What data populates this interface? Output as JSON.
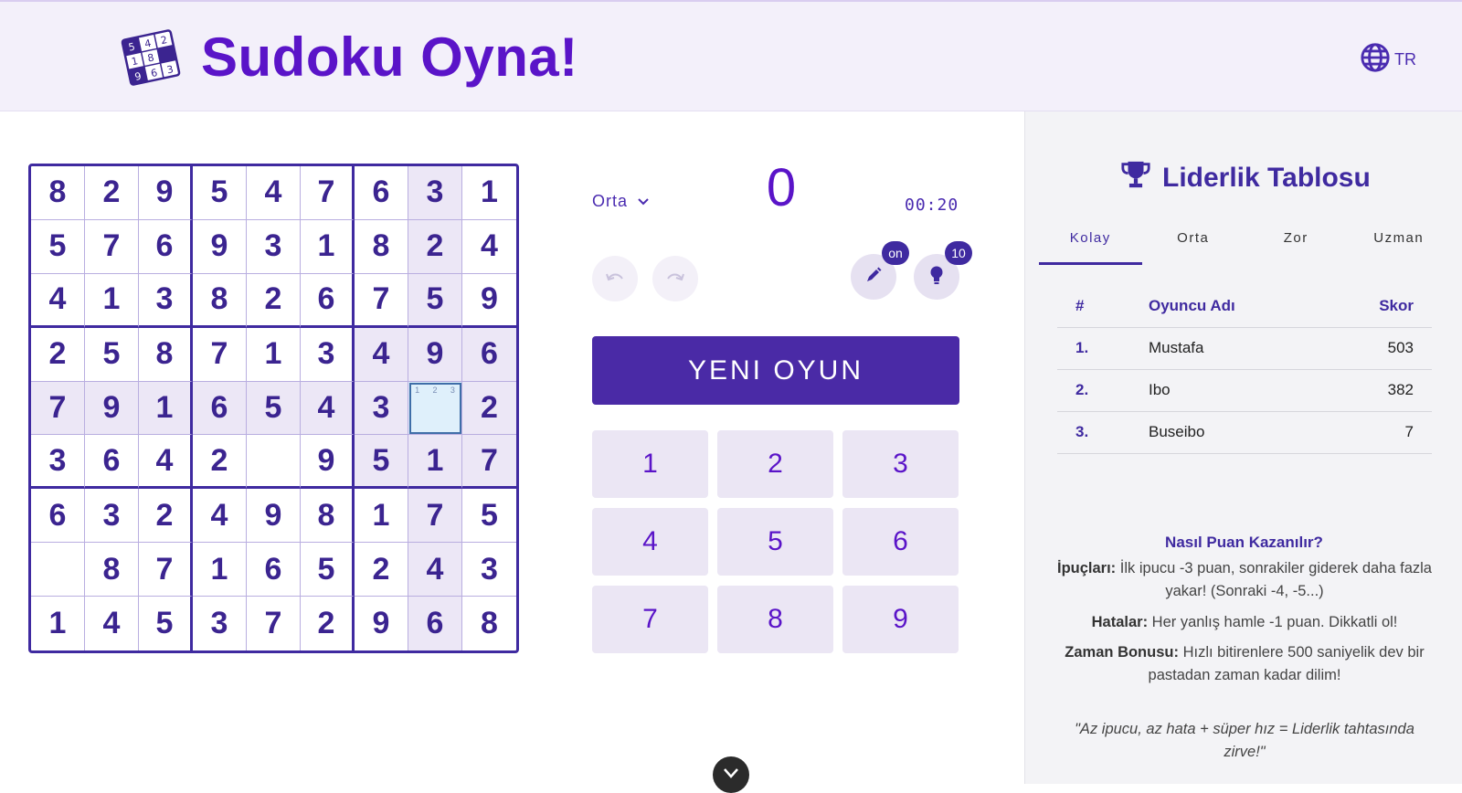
{
  "header": {
    "title": "Sudoku Oyna!",
    "logo_digits": [
      "5",
      "4",
      "2",
      "1",
      "8",
      "9",
      "6",
      "3"
    ],
    "language": "TR"
  },
  "board": {
    "cells": [
      [
        "8",
        "2",
        "9",
        "5",
        "4",
        "7",
        "6",
        "3",
        "1"
      ],
      [
        "5",
        "7",
        "6",
        "9",
        "3",
        "1",
        "8",
        "2",
        "4"
      ],
      [
        "4",
        "1",
        "3",
        "8",
        "2",
        "6",
        "7",
        "5",
        "9"
      ],
      [
        "2",
        "5",
        "8",
        "7",
        "1",
        "3",
        "4",
        "9",
        "6"
      ],
      [
        "7",
        "9",
        "1",
        "6",
        "5",
        "4",
        "3",
        "",
        "2"
      ],
      [
        "3",
        "6",
        "4",
        "2",
        "",
        "9",
        "5",
        "1",
        "7"
      ],
      [
        "6",
        "3",
        "2",
        "4",
        "9",
        "8",
        "1",
        "7",
        "5"
      ],
      [
        "",
        "8",
        "7",
        "1",
        "6",
        "5",
        "2",
        "4",
        "3"
      ],
      [
        "1",
        "4",
        "5",
        "3",
        "7",
        "2",
        "9",
        "6",
        "8"
      ]
    ],
    "selected_cell_notes": [
      "1",
      "2",
      "3"
    ]
  },
  "controls": {
    "difficulty": "Orta",
    "score": "0",
    "timer": "00:20",
    "pencil_badge": "on",
    "hint_badge": "10",
    "new_game_label": "YENI OYUN",
    "numpad": [
      "1",
      "2",
      "3",
      "4",
      "5",
      "6",
      "7",
      "8",
      "9"
    ]
  },
  "leaderboard": {
    "title": "Liderlik Tablosu",
    "tabs": [
      "Kolay",
      "Orta",
      "Zor",
      "Uzman"
    ],
    "active_tab": "Kolay",
    "columns": {
      "rank": "#",
      "name": "Oyuncu Adı",
      "score": "Skor"
    },
    "rows": [
      {
        "rank": "1.",
        "name": "Mustafa",
        "score": "503"
      },
      {
        "rank": "2.",
        "name": "Ibo",
        "score": "382"
      },
      {
        "rank": "3.",
        "name": "Buseibo",
        "score": "7"
      }
    ]
  },
  "rules": {
    "title": "Nasıl Puan Kazanılır?",
    "hints_label": "İpuçları:",
    "hints_text": "İlk ipucu -3 puan, sonrakiler giderek daha fazla yakar! (Sonraki -4, -5...)",
    "errors_label": "Hatalar:",
    "errors_text": "Her yanlış hamle -1 puan. Dikkatli ol!",
    "time_label": "Zaman Bonusu:",
    "time_text": "Hızlı bitirenlere 500 saniyelik dev bir pastadan zaman kadar dilim!",
    "quote": "\"Az ipucu, az hata + süper hız = Liderlik tahtasında zirve!\""
  },
  "colors": {
    "brand": "#5a14c8",
    "primary": "#4a2aa6",
    "highlight": "#ece7f6",
    "selected": "#dff0fb"
  },
  "icons": [
    "sudoku-logo-icon",
    "globe-icon",
    "chevron-down-icon",
    "undo-icon",
    "redo-icon",
    "pencil-icon",
    "lightbulb-icon",
    "trophy-icon",
    "chevron-down-scroll-icon"
  ]
}
